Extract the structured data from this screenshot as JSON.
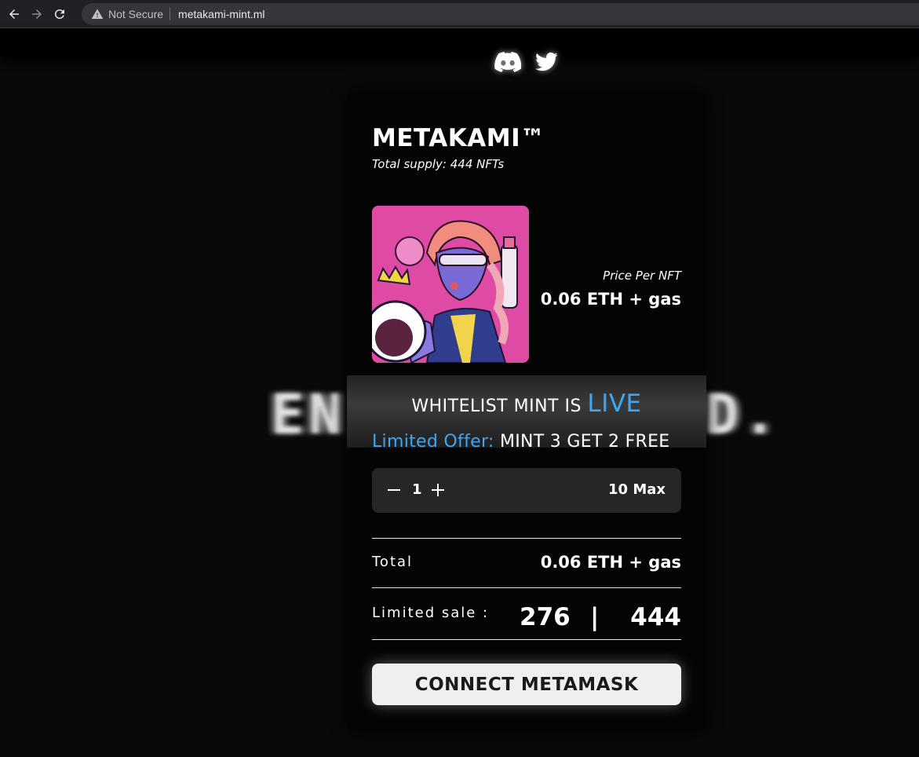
{
  "browser": {
    "security_label": "Not Secure",
    "url": "metakami-mint.ml"
  },
  "socials": {
    "discord_icon": "discord-icon",
    "twitter_icon": "twitter-icon"
  },
  "background": {
    "glitch_left": "EN",
    "glitch_right": "D."
  },
  "card": {
    "title": "METAKAMI™",
    "subtitle": "Total supply: 444 NFTs",
    "price_label": "Price Per NFT",
    "price_value": "0.06 ETH + gas",
    "whitelist_prefix": "WHITELIST MINT IS ",
    "whitelist_status": "LIVE",
    "offer_prefix": "Limited Offer:",
    "offer_text": " MINT 3 GET 2 FREE",
    "quantity": "1",
    "quantity_max": "10 Max",
    "total_label": "Total",
    "total_value": "0.06 ETH + gas",
    "sale_label": "Limited sale :",
    "sale_minted": "276",
    "sale_separator": "|",
    "sale_total": "444",
    "connect_button": "CONNECT METAMASK"
  },
  "colors": {
    "accent": "#3ba7f5",
    "background": "#0a080a",
    "card": "#050405",
    "button": "#efefef"
  }
}
